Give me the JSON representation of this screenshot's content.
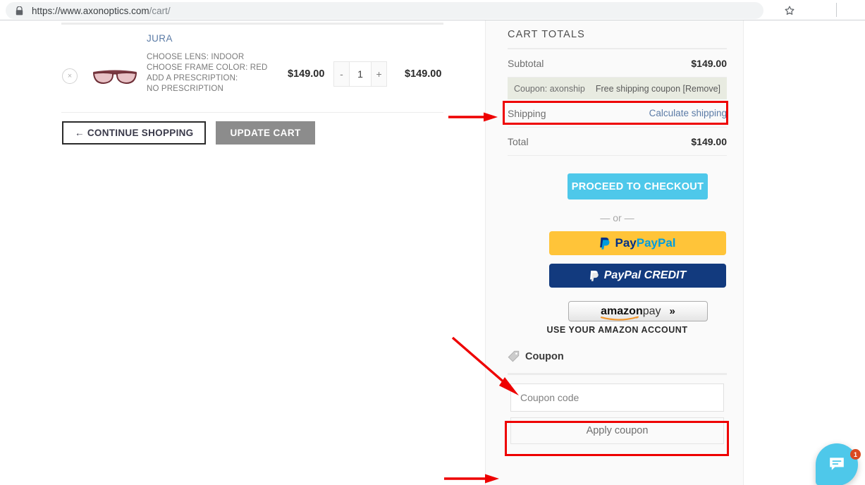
{
  "browser": {
    "url_secure": "https://www.axonoptics.com",
    "url_path": "/cart/",
    "lock_icon": "lock-icon",
    "star_icon": "bookmark-star-icon"
  },
  "cart_item": {
    "title": "JURA",
    "remove_label": "×",
    "attributes": [
      "CHOOSE LENS:  INDOOR",
      "CHOOSE FRAME COLOR:  RED",
      "ADD A PRESCRIPTION:",
      "NO PRESCRIPTION"
    ],
    "unit_price": "$149.00",
    "qty_decrement": "-",
    "qty_value": "1",
    "qty_increment": "+",
    "line_total": "$149.00"
  },
  "cart_actions": {
    "continue_shopping": "← CONTINUE SHOPPING",
    "update_cart": "UPDATE CART"
  },
  "totals": {
    "title": "CART TOTALS",
    "subtotal_label": "Subtotal",
    "subtotal_value": "$149.00",
    "coupon_label": "Coupon: axonship",
    "coupon_value": "Free shipping coupon [Remove]",
    "shipping_label": "Shipping",
    "shipping_link": "Calculate shipping",
    "total_label": "Total",
    "total_value": "$149.00"
  },
  "checkout": {
    "proceed_label": "PROCEED TO CHECKOUT",
    "or_separator": "— or —",
    "paypal_label": "PayPal",
    "paypal_credit_label": "PayPal CREDIT",
    "amazon_label_bold": "amazon",
    "amazon_label_light": "pay",
    "amazon_chevrons": "»",
    "amazon_caption": "USE YOUR AMAZON ACCOUNT"
  },
  "coupon_form": {
    "heading": "Coupon",
    "tag_icon": "price-tag-icon",
    "input_placeholder": "Coupon code",
    "apply_label": "Apply coupon"
  },
  "chat": {
    "icon": "chat-bubble-icon",
    "badge_count": "1"
  },
  "colors": {
    "accent_cyan": "#4ec8ea",
    "coupon_highlight": "#e8ebe1",
    "annotation_red": "#ee0000",
    "paypal_yellow": "#ffc439",
    "paypal_navy": "#123a7e"
  }
}
